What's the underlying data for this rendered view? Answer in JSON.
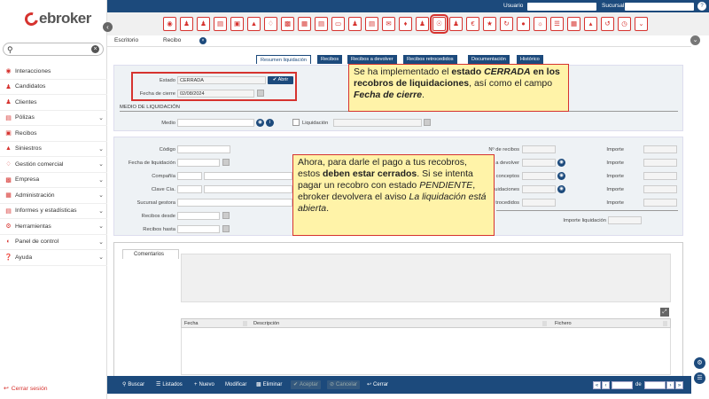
{
  "brand": {
    "name": "ebroker"
  },
  "topbar": {
    "usuario_label": "Usuario",
    "sucursal_label": "Sucursal"
  },
  "sidebar": {
    "items": [
      {
        "label": "Interacciones",
        "icon": "globe-icon",
        "expandable": false
      },
      {
        "label": "Candidatos",
        "icon": "user-plus-icon",
        "expandable": false
      },
      {
        "label": "Clientes",
        "icon": "user-icon",
        "expandable": false
      },
      {
        "label": "Pólizas",
        "icon": "document-icon",
        "expandable": true
      },
      {
        "label": "Recibos",
        "icon": "receipt-icon",
        "expandable": false
      },
      {
        "label": "Siniestros",
        "icon": "fire-icon",
        "expandable": true
      },
      {
        "label": "Gestión comercial",
        "icon": "cart-icon",
        "expandable": true
      },
      {
        "label": "Empresa",
        "icon": "briefcase-icon",
        "expandable": true
      },
      {
        "label": "Administración",
        "icon": "calculator-icon",
        "expandable": true
      },
      {
        "label": "Informes y estadísticas",
        "icon": "chart-icon",
        "expandable": true
      },
      {
        "label": "Herramientas",
        "icon": "gear-icon",
        "expandable": true
      },
      {
        "label": "Panel de control",
        "icon": "dashboard-icon",
        "expandable": true
      },
      {
        "label": "Ayuda",
        "icon": "help-icon",
        "expandable": true
      }
    ],
    "logout": "Cerrar sesión"
  },
  "doctabs": {
    "tab1": "Escritorio",
    "tab2": "Recibo"
  },
  "subtabs": [
    "Resumen liquidación",
    "Recibos",
    "Recibos a devolver",
    "Recibos retrocedidos",
    "Documentación",
    "Histórico"
  ],
  "form1": {
    "estado_label": "Estado",
    "estado_value": "CERRADA",
    "abrir_label": "Abrir",
    "fecha_cierre_label": "Fecha de cierre",
    "fecha_cierre_value": "02/08/2024",
    "section_title": "MEDIO DE LIQUIDACIÓN",
    "medio_label": "Medio",
    "liquidacion_label": "Liquidación"
  },
  "form2": {
    "codigo": "Código",
    "fecha_liq": "Fecha de liquidación",
    "compania": "Compañía",
    "clave_cia": "Clave Cía.",
    "sucursal_gestora": "Sucursal gestora",
    "recibos_desde": "Recibos desde",
    "recibos_hasta": "Recibos hasta",
    "n_recibos": "Nº de recibos",
    "a_devolver": "a devolver",
    "conceptos": "conceptos",
    "uidaciones": "uidaciones",
    "trocedidos": "trocedidos",
    "importe": "Importe",
    "importe_liq": "Importe liquidación"
  },
  "notes": {
    "note1": {
      "p1": "Se ha implementado el ",
      "b1": "estado ",
      "bi1": "CERRADA",
      "b2": "en los recobros de liquidaciones",
      "p2": ", así como el campo ",
      "bi2": "Fecha de cierre",
      "p3": "."
    },
    "note2": {
      "p1": "Ahora, para darle el pago a tus recobros, estos ",
      "b1": "deben estar cerrados",
      "p2": ". Si se intenta pagar un recobro con estado ",
      "i1": "PENDIENTE",
      "p3": ", ebroker devolvera el aviso ",
      "i2": "La liquidación está abierta",
      "p4": "."
    }
  },
  "comments": {
    "tab": "Comentarios",
    "col_fecha": "Fecha",
    "col_descripcion": "Descripción",
    "col_fichero": "Fichero"
  },
  "toolbar": {
    "buscar": "Buscar",
    "listados": "Listados",
    "nuevo": "Nuevo",
    "modificar": "Modificar",
    "eliminar": "Eliminar",
    "aceptar": "Aceptar",
    "cancelar": "Cancelar",
    "cerrar": "Cerrar",
    "pager_de": "de"
  },
  "colors": {
    "primary": "#1c4a7c",
    "accent": "#d6332f",
    "note_bg": "#fff3a8"
  }
}
